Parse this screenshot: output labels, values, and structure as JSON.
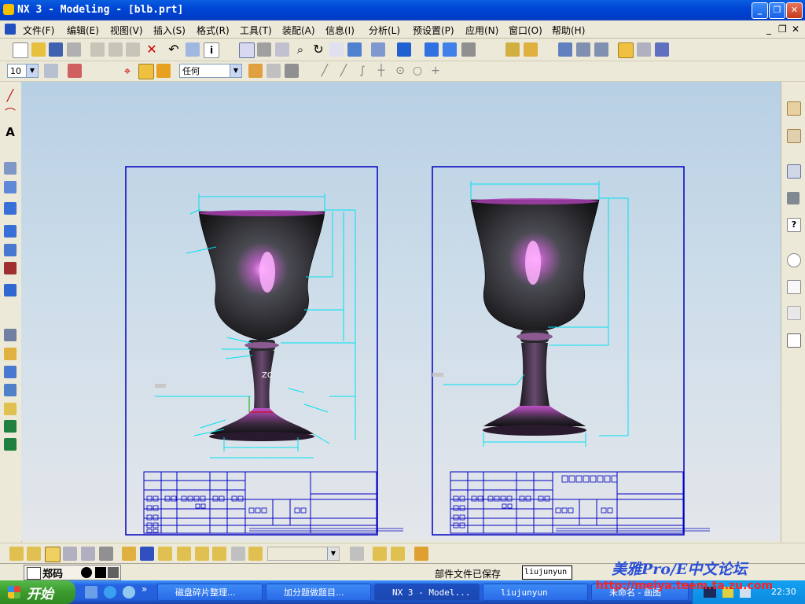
{
  "window": {
    "title": "NX 3 - Modeling - [blb.prt]",
    "buttons": [
      "_",
      "❐",
      "✕"
    ]
  },
  "menu": {
    "items": [
      "文件(F)",
      "编辑(E)",
      "视图(V)",
      "插入(S)",
      "格式(R)",
      "工具(T)",
      "装配(A)",
      "信息(I)",
      "分析(L)",
      "预设置(P)",
      "应用(N)",
      "窗口(O)",
      "帮助(H)"
    ],
    "mdi_buttons": [
      "_",
      "❐",
      "✕"
    ]
  },
  "toolbar2": {
    "layer_value": "10",
    "filter_value": "任何"
  },
  "drawing_left": {
    "label_c": "ZC"
  },
  "status": {
    "ime_label": "郑码",
    "message": "部件文件已保存",
    "user_box": "liujunyun",
    "watermark_title": "美雅Pro/E中文论坛",
    "watermark_url": "http://meiya.teem.ta.zu.com"
  },
  "taskbar": {
    "start_label": "开始",
    "tasks": [
      "磁盘碎片整理...",
      "加分题做题目...",
      "NX 3 - Model...",
      "liujunyun",
      "未命名 - 画图"
    ],
    "clock": "22:30"
  },
  "colors": {
    "frame_blue": "#0000c0",
    "dim_cyan": "#00e0f0",
    "canvas_top": "#b8d0e4",
    "goblet_highlight": "#ff80ff"
  }
}
